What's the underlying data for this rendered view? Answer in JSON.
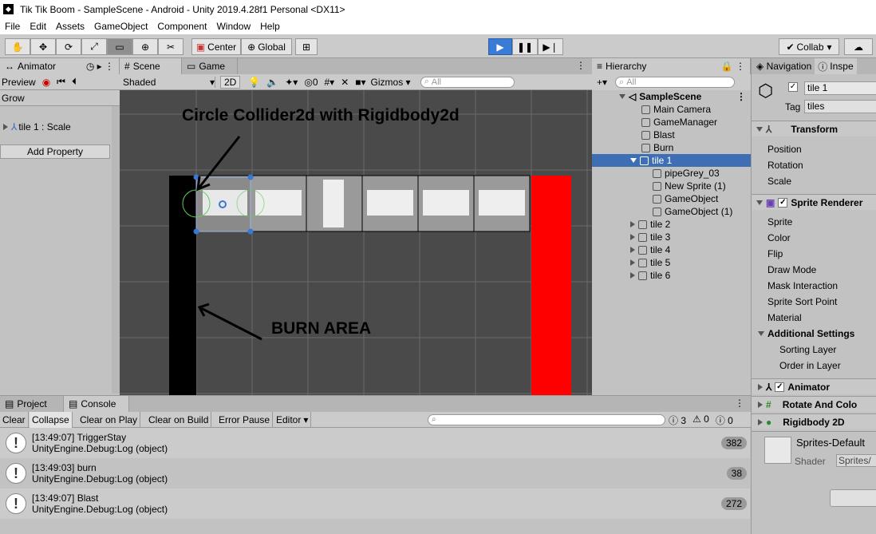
{
  "window": {
    "title": "Tik Tik Boom - SampleScene - Android - Unity 2019.4.28f1 Personal <DX11>"
  },
  "menu": [
    "File",
    "Edit",
    "Assets",
    "GameObject",
    "Component",
    "Window",
    "Help"
  ],
  "toolbar": {
    "center": "Center",
    "global": "Global",
    "collab": "Collab"
  },
  "animator": {
    "tab": "Animator",
    "preview": "Preview",
    "clip": "Grow",
    "property": "tile 1 : Scale",
    "add_property": "Add Property"
  },
  "scene": {
    "tab_scene": "Scene",
    "tab_game": "Game",
    "shading": "Shaded",
    "mode_2d": "2D",
    "hidden_count": "0",
    "gizmos": "Gizmos",
    "search_placeholder": "All",
    "annotation_top": "Circle Collider2d with Rigidbody2d",
    "annotation_bottom": "BURN AREA"
  },
  "hierarchy": {
    "tab": "Hierarchy",
    "search_placeholder": "All",
    "scene": "SampleScene",
    "items": [
      "Main Camera",
      "GameManager",
      "Blast",
      "Burn",
      "tile 1",
      "pipeGrey_03",
      "New Sprite (1)",
      "GameObject",
      "GameObject (1)",
      "tile 2",
      "tile 3",
      "tile 4",
      "tile 5",
      "tile 6"
    ]
  },
  "inspector": {
    "tab_nav": "Navigation",
    "tab_insp": "Inspe",
    "name": "tile 1",
    "tag_label": "Tag",
    "tag": "tiles",
    "transform": "Transform",
    "transform_fields": [
      "Position",
      "Rotation",
      "Scale"
    ],
    "sprite_renderer": "Sprite Renderer",
    "sr_fields": [
      "Sprite",
      "Color",
      "Flip",
      "Draw Mode",
      "Mask Interaction",
      "Sprite Sort Point",
      "Material"
    ],
    "additional": "Additional Settings",
    "add_fields": [
      "Sorting Layer",
      "Order in Layer"
    ],
    "animator": "Animator",
    "rotate": "Rotate And Colo",
    "rigidbody": "Rigidbody 2D",
    "material": "Sprites-Default",
    "shader_label": "Shader",
    "shader": "Sprites/"
  },
  "console": {
    "tab_project": "Project",
    "tab_console": "Console",
    "clear": "Clear",
    "collapse": "Collapse",
    "clear_on_play": "Clear on Play",
    "clear_on_build": "Clear on Build",
    "error_pause": "Error Pause",
    "editor": "Editor",
    "log_count": "3",
    "warn_count": "0",
    "err_count": "0",
    "logs": [
      {
        "line1": "[13:49:07] TriggerStay",
        "line2": "UnityEngine.Debug:Log (object)",
        "count": "382"
      },
      {
        "line1": "[13:49:03] burn",
        "line2": "UnityEngine.Debug:Log (object)",
        "count": "38"
      },
      {
        "line1": "[13:49:07] Blast",
        "line2": "UnityEngine.Debug:Log (object)",
        "count": "272"
      }
    ]
  },
  "colors": {
    "play": "#3a7bd5",
    "selected": "#3e6fb4",
    "burn_red": "#ff0000"
  }
}
